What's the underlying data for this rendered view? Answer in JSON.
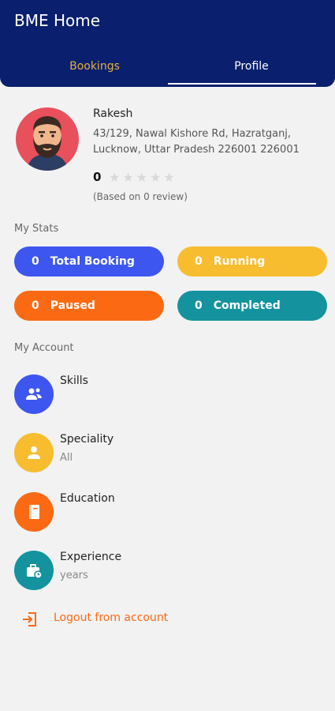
{
  "header": {
    "title": "BME Home",
    "tabs": [
      {
        "label": "Bookings"
      },
      {
        "label": "Profile"
      }
    ],
    "active_tab": "Profile",
    "colors": {
      "appbar": "#0a1f6e",
      "inactive_tab": "#e5b23a",
      "active_tab": "#ffffff"
    }
  },
  "profile": {
    "name": "Rakesh",
    "address": "43/129, Nawal Kishore Rd, Hazratganj, Lucknow, Uttar Pradesh 226001 226001",
    "rating": "0",
    "stars": "★★★★★",
    "review_note": "(Based on 0 review)",
    "avatar_icon": "man-avatar-icon"
  },
  "stats": {
    "section_label": "My Stats",
    "items": [
      {
        "count": "0",
        "label": "Total Booking",
        "color": "#3d56f0"
      },
      {
        "count": "0",
        "label": "Running",
        "color": "#f7bd2f"
      },
      {
        "count": "0",
        "label": "Paused",
        "color": "#fb6a13"
      },
      {
        "count": "0",
        "label": "Completed",
        "color": "#14939e"
      }
    ]
  },
  "account": {
    "section_label": "My Account",
    "items": [
      {
        "title": "Skills",
        "subtitle": "",
        "icon": "users-icon",
        "color": "#3d56f0"
      },
      {
        "title": "Speciality",
        "subtitle": "All",
        "icon": "person-icon",
        "color": "#f7bd2f"
      },
      {
        "title": "Education",
        "subtitle": "",
        "icon": "book-icon",
        "color": "#fb6a13"
      },
      {
        "title": "Experience",
        "subtitle": " years",
        "icon": "briefcase-clock-icon",
        "color": "#14939e"
      }
    ]
  },
  "logout": {
    "label": "Logout from account",
    "icon": "logout-icon",
    "color": "#fb6a13"
  }
}
